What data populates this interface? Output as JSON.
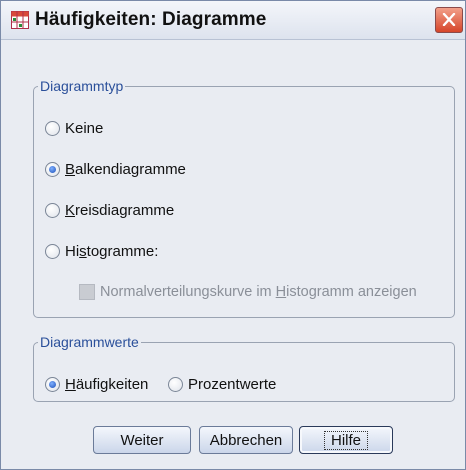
{
  "window": {
    "title": "Häufigkeiten: Diagramme",
    "title_icon": "bar-chart-table-icon",
    "close_icon": "close-icon"
  },
  "diagrammtyp": {
    "legend": "Diagrammtyp",
    "options": [
      {
        "label_pre": "",
        "label_u": "",
        "label_post": "Keine",
        "checked": false
      },
      {
        "label_pre": "",
        "label_u": "B",
        "label_post": "alkendiagramme",
        "checked": true
      },
      {
        "label_pre": "",
        "label_u": "K",
        "label_post": "reisdiagramme",
        "checked": false
      },
      {
        "label_pre": "Hi",
        "label_u": "s",
        "label_post": "togramme:",
        "checked": false
      }
    ],
    "normal_curve": {
      "label_pre": "Normalverteilungskurve im ",
      "label_u": "H",
      "label_post": "istogramm anzeigen",
      "checked": false,
      "enabled": false
    }
  },
  "diagrammwerte": {
    "legend": "Diagrammwerte",
    "options": [
      {
        "label_pre": "",
        "label_u": "H",
        "label_post": "äufigkeiten",
        "checked": true
      },
      {
        "label_pre": "",
        "label_u": "",
        "label_post": "Prozentwerte",
        "checked": false
      }
    ]
  },
  "buttons": {
    "weiter": "Weiter",
    "abbrechen": "Abbrechen",
    "hilfe": "Hilfe"
  }
}
